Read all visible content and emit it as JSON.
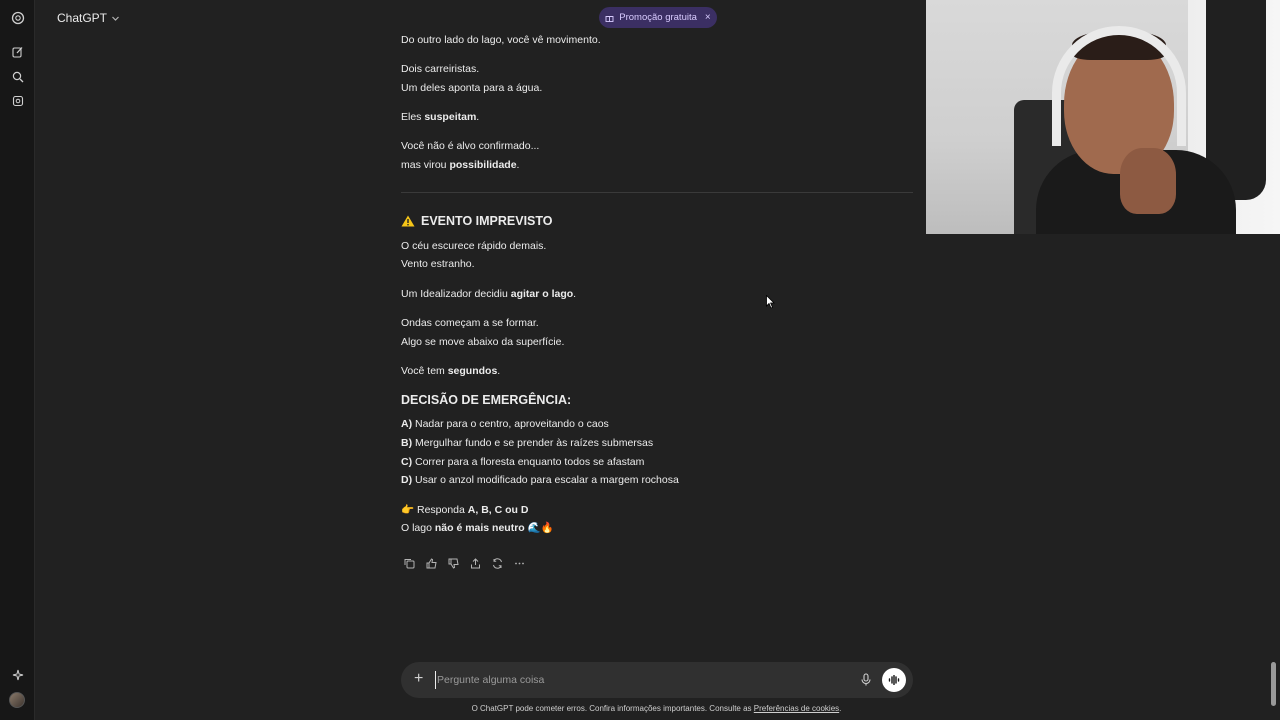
{
  "header": {
    "title": "ChatGPT",
    "promo_label": "Promoção gratuita",
    "promo_close": "×"
  },
  "message": {
    "block1": [
      {
        "t": "Do outro lado do lago, você vê movimento."
      },
      {
        "t": "Dois carreiristas."
      },
      {
        "t": "Um deles aponta para a água."
      },
      {
        "pre": "Eles ",
        "b": "suspeitam",
        "post": "."
      },
      {
        "t": "Você não é alvo confirmado..."
      },
      {
        "pre": "mas virou ",
        "b": "possibilidade",
        "post": "."
      }
    ],
    "event_title": "EVENTO IMPREVISTO",
    "block2": [
      {
        "t": "O céu escurece rápido demais."
      },
      {
        "t": "Vento estranho."
      },
      {
        "pre": "Um Idealizador decidiu ",
        "b": "agitar o lago",
        "post": "."
      },
      {
        "t": "Ondas começam a se formar."
      },
      {
        "t": "Algo se move abaixo da superfície."
      },
      {
        "pre": "Você tem ",
        "b": "segundos",
        "post": "."
      }
    ],
    "decision_title": "DECISÃO DE EMERGÊNCIA:",
    "options": [
      {
        "key": "A)",
        "text": " Nadar para o centro, aproveitando o caos"
      },
      {
        "key": "B)",
        "text": " Mergulhar fundo e se prender às raízes submersas"
      },
      {
        "key": "C)",
        "text": " Correr para a floresta enquanto todos se afastam"
      },
      {
        "key": "D)",
        "text": " Usar o anzol modificado para escalar a margem rochosa"
      }
    ],
    "respond": {
      "emoji": "👉",
      "pre": " Responda ",
      "b": "A, B, C ou D"
    },
    "closing": {
      "pre": "O lago ",
      "b": "não é mais neutro",
      "post": " 🌊🔥"
    }
  },
  "composer": {
    "placeholder": "Pergunte alguma coisa"
  },
  "footer": {
    "text": "O ChatGPT pode cometer erros. Confira informações importantes. Consulte as ",
    "link": "Preferências de cookies",
    "end": "."
  },
  "icons": {
    "rail": [
      "openai-logo-icon",
      "new-chat-icon",
      "search-icon",
      "library-icon",
      "sparkle-icon"
    ],
    "actions": [
      "copy-icon",
      "thumbs-up-icon",
      "thumbs-down-icon",
      "share-icon",
      "regenerate-icon",
      "more-icon"
    ]
  },
  "colors": {
    "background": "#212121",
    "sidebar": "#171717",
    "promo_bg": "#3b2f63",
    "promo_text": "#d9ccff",
    "warning": "#f5c518"
  }
}
